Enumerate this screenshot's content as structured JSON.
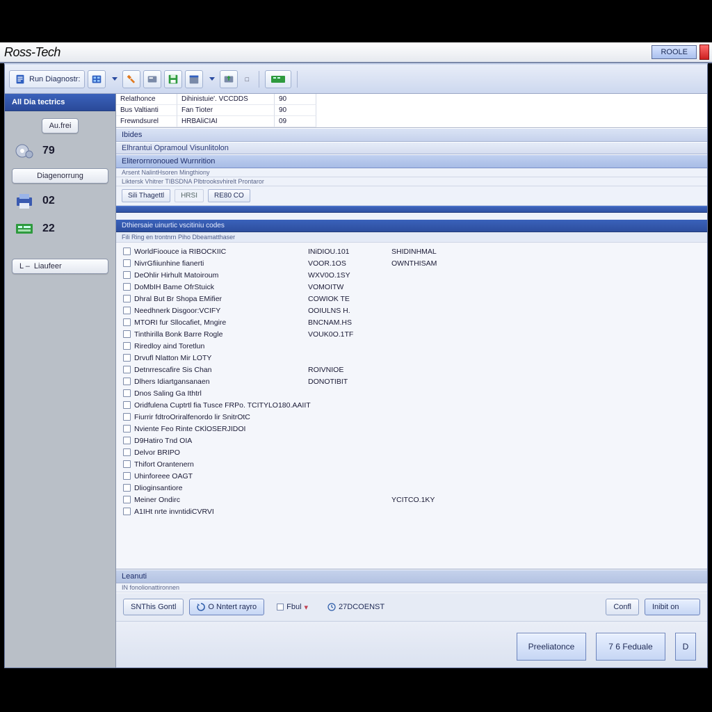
{
  "brand": {
    "a": "Ross",
    "b": "-Tech"
  },
  "top_right": {
    "roole": "ROOLE"
  },
  "toolbar": {
    "run": "Run Diagnostr:"
  },
  "sidebar": {
    "header": "All Dia tectrics",
    "btn_aufrei": "Au.frei",
    "val1": "79",
    "btn_diag": "Diagenorrung",
    "val2": "02",
    "val3": "22",
    "btn_lauf": "Liaufeer",
    "btn_lauf_prefix": "L –"
  },
  "info": {
    "rows": [
      [
        "Relathonce",
        "Dihinistuie'. VCCDDS",
        "90"
      ],
      [
        "Bus Valtianti",
        "Fan Tioter",
        "90"
      ],
      "[\"Frewndsurel\", \"HRBAliCIAI\", \"09\"]"
    ],
    "r1": [
      "Relathonce",
      "Dihinistuie'. VCCDDS",
      "90"
    ],
    "r2": [
      "Bus Valtianti",
      "Fan Tioter",
      "90"
    ],
    "r3": [
      "Frewndsurel",
      "HRBAliCIAI",
      "09"
    ]
  },
  "panels": {
    "p1": "Ibides",
    "p2": "Elhrantui Opramoul Visunlitolon",
    "p3": "Eliterornronoued Wurnrition",
    "p3_sub": "Arsent NalintHsoren Mingthiony",
    "subcap": "Liktersk Vhitrer       TIBSDNA Plbtrooksvhirelt Prontaror"
  },
  "tabs": {
    "t1": "Sili  Thagettl",
    "t2": "HRSI",
    "t3": "RE80 CO"
  },
  "section": {
    "title": "Dthiersaie uinurtic vscitiniu codes",
    "sub": "Fili Ring en trontnrn Piho Dbeamatthaser"
  },
  "rows": [
    {
      "n": "WorldFioouce ia RIBOCKIIC",
      "c1": "INiDIOU.101",
      "c2": "SHIDINHMAL"
    },
    {
      "n": "NivrGfiiunhine fianerti",
      "c1": "VOOR.1OS",
      "c2": "OWNTHISAM"
    },
    {
      "n": "DeOhlir Hirhult Matoiroum",
      "c1": "WXV0O.1SY",
      "c2": ""
    },
    {
      "n": "DoMbIH Bame OfrStuick",
      "c1": "VOMOITW",
      "c2": ""
    },
    {
      "n": "Dhral But Br Shopa EMifier",
      "c1": "COWIOK TE",
      "c2": ""
    },
    {
      "n": "Needhnerk Disgoor:VCIFY",
      "c1": "OOIULNS H.",
      "c2": ""
    },
    {
      "n": "MTORI fur Sllocafiet, Mngire",
      "c1": "BNCNAM.HS",
      "c2": ""
    },
    {
      "n": "Tinthirilla Bonk Barre Rogle",
      "c1": "VOUK0O.1TF",
      "c2": ""
    },
    {
      "n": "Riredloy aind Toretlun",
      "c1": "",
      "c2": ""
    },
    {
      "n": "Drvufl Nlatton Mir LOTY",
      "c1": "",
      "c2": ""
    },
    {
      "n": "Detnrrescafire Sis Chan",
      "c1": "ROIVNIOE",
      "c2": ""
    },
    {
      "n": "Dlhers Idiartgansanaen",
      "c1": "DONOTIBIT",
      "c2": ""
    },
    {
      "n": "Dnos Saling Ga Ithtrl",
      "c1": "",
      "c2": ""
    },
    {
      "n": "Oridfulena Cuptrtl fia Tusce FRPo.  TCITYLO180.AAIIT",
      "c1": "",
      "c2": ""
    },
    {
      "n": "Fiurrir fdtroOriralfenordo lir SnitrOtC",
      "c1": "",
      "c2": ""
    },
    {
      "n": "Nviente Feo Rinte CKlOSERJIDOI",
      "c1": "",
      "c2": ""
    },
    {
      "n": "D9Hatiro Tnd OIA",
      "c1": "",
      "c2": ""
    },
    {
      "n": "Delvor BRIPO",
      "c1": "",
      "c2": ""
    },
    {
      "n": "Thifort Orantenern",
      "c1": "",
      "c2": ""
    },
    {
      "n": "Uhinforeee OAGT",
      "c1": "",
      "c2": ""
    },
    {
      "n": "Dlioginsantiore",
      "c1": "",
      "c2": ""
    },
    {
      "n": "Meiner Ondirc",
      "c1": "",
      "c2": "YCITCO.1KY"
    },
    {
      "n": "A1IHt nrte invntidiCVRVI",
      "c1": "",
      "c2": ""
    }
  ],
  "lower": {
    "hdr": "Leanuti",
    "sub": "IN fonolionattironnen",
    "btn1": "SNThis Gontl",
    "btn2": "O Nntert rayro",
    "btn3": "Fbul",
    "btn4": "27DCOENST",
    "conf": "Confl",
    "edit": "Inibit on"
  },
  "footer": {
    "b1": "Preeliatonce",
    "b2": "7 6 Feduale",
    "b3": "D"
  }
}
